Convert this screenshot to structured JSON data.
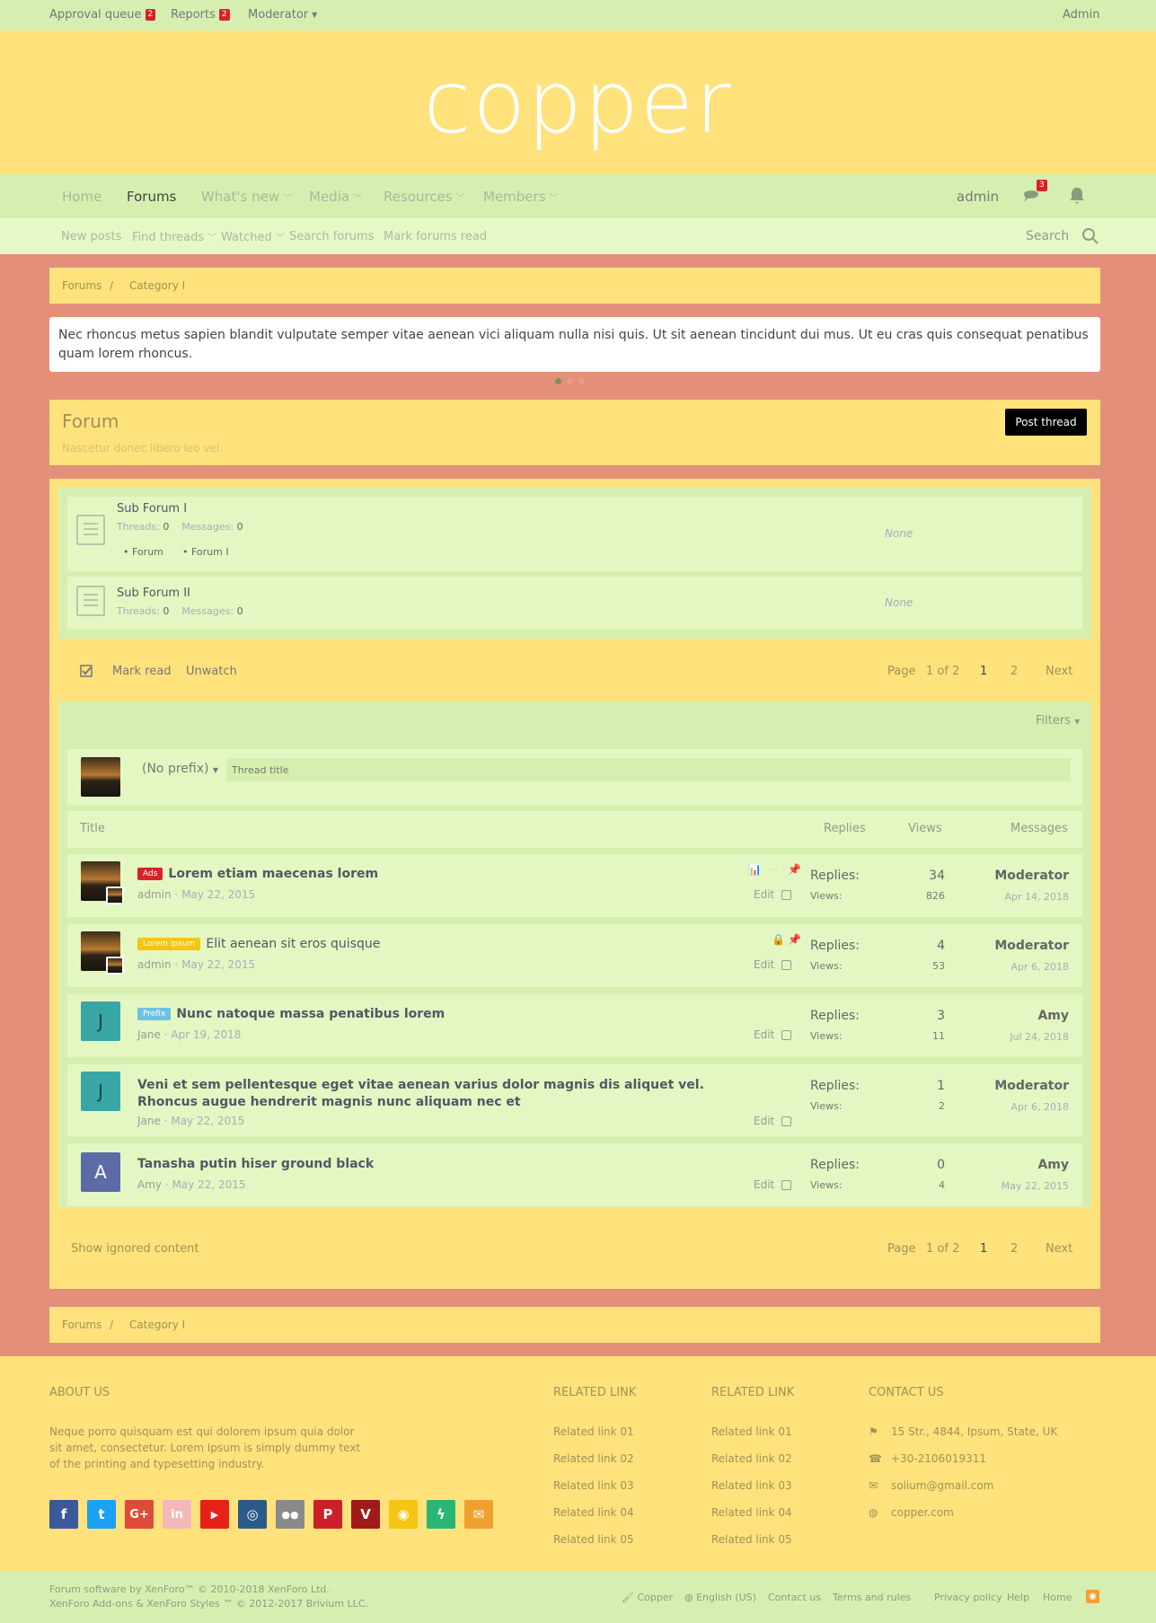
{
  "staffbar": {
    "approval_queue": "Approval queue",
    "approval_count": "2",
    "reports": "Reports",
    "reports_count": "2",
    "moderator": "Moderator",
    "admin": "Admin"
  },
  "logo": {
    "text": "copper"
  },
  "nav": {
    "tabs": [
      "Home",
      "Forums",
      "What's new",
      "Media",
      "Resources",
      "Members"
    ],
    "selected": "Forums",
    "user": "admin",
    "conversations_count": "3"
  },
  "subnav": {
    "items": [
      "New posts",
      "Find threads",
      "Watched",
      "Search forums",
      "Mark forums read"
    ],
    "search": "Search"
  },
  "breadcrumb": {
    "items": [
      "Forums",
      "Category I"
    ],
    "sep": "/"
  },
  "notice": {
    "text": "Nec rhoncus metus sapien blandit vulputate semper vitae aenean vici aliquam nulla nisi quis. Ut sit aenean tincidunt dui mus. Ut eu cras quis consequat penatibus quam lorem rhoncus."
  },
  "forum": {
    "title": "Forum",
    "description": "Nascetur donec libero leo vel.",
    "post_thread": "Post thread"
  },
  "subforums": [
    {
      "title": "Sub Forum I",
      "threads_label": "Threads:",
      "threads": "0",
      "messages_label": "Messages:",
      "messages": "0",
      "links": [
        "Forum",
        "Forum I"
      ],
      "last": "None"
    },
    {
      "title": "Sub Forum II",
      "threads_label": "Threads:",
      "threads": "0",
      "messages_label": "Messages:",
      "messages": "0",
      "links": [],
      "last": "None"
    }
  ],
  "actions": {
    "mark_read": "Mark read",
    "unwatch": "Unwatch"
  },
  "pagination": {
    "page_label": "Page",
    "of": "1 of 2",
    "pages": [
      "1",
      "2"
    ],
    "next": "Next"
  },
  "filters": {
    "label": "Filters"
  },
  "quick_thread": {
    "prefix": "(No prefix)",
    "placeholder": "Thread title"
  },
  "columns": {
    "title": "Title",
    "replies": "Replies",
    "views": "Views",
    "messages": "Messages"
  },
  "threads": [
    {
      "prefix": "Ads",
      "prefix_color": "#d8222a",
      "title": "Lorem etiam maecenas lorem",
      "author": "admin",
      "date": "May 22, 2015",
      "replies_label": "Replies:",
      "replies": "34",
      "views_label": "Views:",
      "views": "826",
      "last_user": "Moderator",
      "last_date": "Apr 14, 2018",
      "edit": "Edit",
      "avatar": "photo"
    },
    {
      "prefix": "Lorem ipsum",
      "prefix_color": "#f5c414",
      "title": "Elit aenean sit eros quisque",
      "author": "admin",
      "date": "May 22, 2015",
      "replies_label": "Replies:",
      "replies": "4",
      "views_label": "Views:",
      "views": "53",
      "last_user": "Moderator",
      "last_date": "Apr 6, 2018",
      "edit": "Edit",
      "avatar": "photo"
    },
    {
      "prefix": "Prefix",
      "prefix_color": "#6cc1e5",
      "title": "Nunc natoque massa penatibus lorem",
      "author": "Jane",
      "date": "Apr 19, 2018",
      "replies_label": "Replies:",
      "replies": "3",
      "views_label": "Views:",
      "views": "11",
      "last_user": "Amy",
      "last_date": "Jul 24, 2018",
      "edit": "Edit",
      "avatar": "J"
    },
    {
      "prefix": "",
      "prefix_color": "",
      "title": "Veni et sem pellentesque eget vitae aenean varius dolor magnis dis aliquet vel. Rhoncus augue hendrerit magnis nunc aliquam nec et",
      "author": "Jane",
      "date": "May 22, 2015",
      "replies_label": "Replies:",
      "replies": "1",
      "views_label": "Views:",
      "views": "2",
      "last_user": "Moderator",
      "last_date": "Apr 6, 2018",
      "edit": "Edit",
      "avatar": "J"
    },
    {
      "prefix": "",
      "prefix_color": "",
      "title": "Tanasha putin hiser ground black",
      "author": "Amy",
      "date": "May 22, 2015",
      "replies_label": "Replies:",
      "replies": "0",
      "views_label": "Views:",
      "views": "4",
      "last_user": "Amy",
      "last_date": "May 22, 2015",
      "edit": "Edit",
      "avatar": "A"
    }
  ],
  "show_ignored": "Show ignored content",
  "footer": {
    "about_title": "ABOUT US",
    "about_text": [
      "Neque porro quisquam est qui dolorem ipsum quia dolor",
      "sit amet, consectetur. Lorem Ipsum is simply dummy text",
      "of the printing and typesetting industry."
    ],
    "related1_title": "RELATED LINK",
    "related1": [
      "Related link 01",
      "Related link 02",
      "Related link 03",
      "Related link 04",
      "Related link 05"
    ],
    "related2_title": "RELATED LINK",
    "related2": [
      "Related link 01",
      "Related link 02",
      "Related link 03",
      "Related link 04",
      "Related link 05"
    ],
    "contact_title": "CONTACT US",
    "contact": [
      "15 Str., 4844, Ipsum, State, UK",
      "+30-2106019311",
      "solium@gmail.com",
      "copper.com"
    ],
    "social": [
      {
        "name": "facebook-icon",
        "glyph": "f",
        "color": "#3b5998"
      },
      {
        "name": "twitter-icon",
        "glyph": "🐦",
        "color": "#1da1f2"
      },
      {
        "name": "google-plus-icon",
        "glyph": "G+",
        "color": "#dd4b39"
      },
      {
        "name": "linkedin-icon",
        "glyph": "in",
        "color": "#f4b8b8"
      },
      {
        "name": "youtube-icon",
        "glyph": "▶",
        "color": "#e62117"
      },
      {
        "name": "dribbble-icon",
        "glyph": "⚽",
        "color": "#2b5a8a"
      },
      {
        "name": "flickr-icon",
        "glyph": "••",
        "color": "#8a8a8a"
      },
      {
        "name": "pinterest-icon",
        "glyph": "P",
        "color": "#cb2027"
      },
      {
        "name": "vimeo-icon",
        "glyph": "V",
        "color": "#a01a1a"
      },
      {
        "name": "rss-icon",
        "glyph": "◉",
        "color": "#f5c414"
      },
      {
        "name": "deviantart-icon",
        "glyph": "⚡",
        "color": "#2ab574"
      },
      {
        "name": "email-icon",
        "glyph": "✉",
        "color": "#f0a030"
      }
    ]
  },
  "copyright": {
    "line1": "Forum software by XenForo™ © 2010-2018 XenForo Ltd.",
    "line2": "XenForo Add-ons & XenForo Styles ™ © 2012-2017 Brivium LLC.",
    "links": [
      "Copper",
      "English (US)",
      "Contact us",
      "Terms and rules",
      "Privacy policy",
      "Help",
      "Home"
    ]
  },
  "colors": {
    "accent": "#ffe27c",
    "background": "#e38f7a",
    "nav": "#d6efb0",
    "row": "#e4f7c2"
  }
}
